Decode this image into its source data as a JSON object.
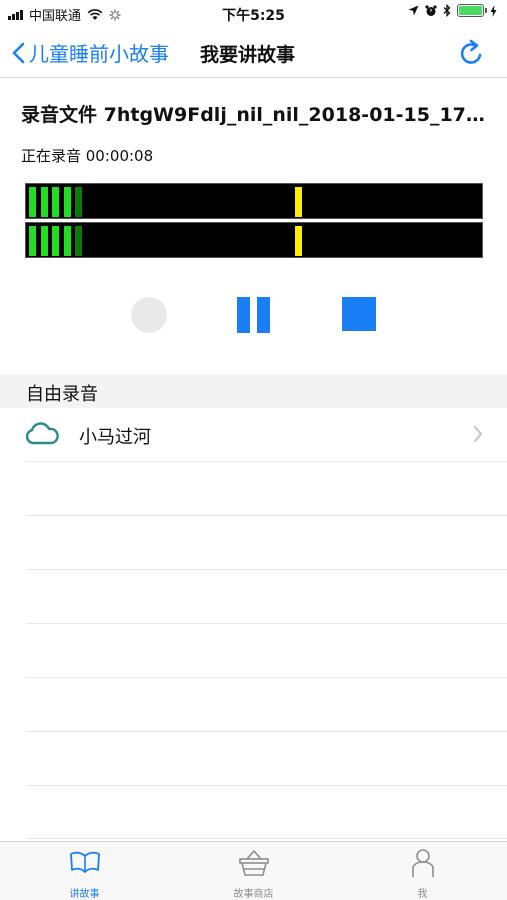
{
  "status_bar": {
    "carrier": "中国联通",
    "time": "下午5:25"
  },
  "nav": {
    "back_label": "儿童睡前小故事",
    "title": "我要讲故事"
  },
  "recording": {
    "file_label": "录音文件 7htgW9Fdlj_nil_nil_2018-01-15_17-2...",
    "status_text": "正在录音 00:00:08"
  },
  "level_meters": [
    {
      "level_segments": 5,
      "peak_fraction": 0.6
    },
    {
      "level_segments": 5,
      "peak_fraction": 0.6
    }
  ],
  "section": {
    "title": "自由录音"
  },
  "list_items": [
    {
      "label": "小马过河",
      "icon": "cloud-icon"
    }
  ],
  "tab_bar": {
    "tabs": [
      {
        "label": "讲故事",
        "icon": "open-book-icon",
        "active": true
      },
      {
        "label": "故事商店",
        "icon": "basket-icon",
        "active": false
      },
      {
        "label": "我",
        "icon": "person-icon",
        "active": false
      }
    ]
  },
  "colors": {
    "accent": "#1a7ff5",
    "meter_green": "#22dd22",
    "meter_dark_green": "#0a7a0a",
    "meter_peak": "#ffee00",
    "cloud": "#2a8a8a"
  }
}
